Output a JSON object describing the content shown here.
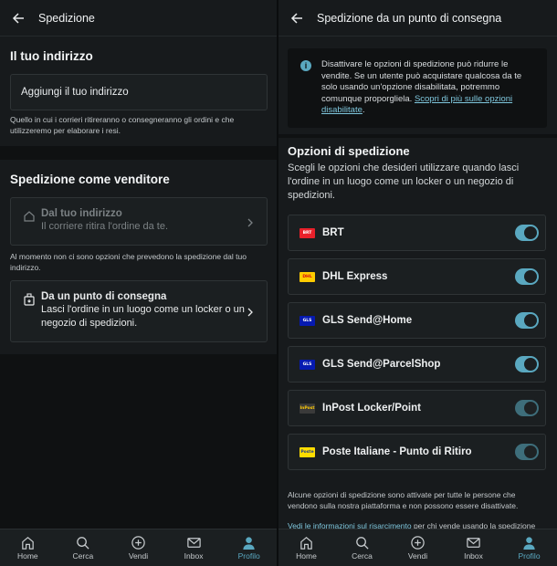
{
  "colors": {
    "accent": "#5aa8c0",
    "background": "#171a1c",
    "card": "#1b1f21"
  },
  "left": {
    "title": "Spedizione",
    "address_section": {
      "title": "Il tuo indirizzo",
      "add_button": "Aggiungi il tuo indirizzo",
      "helper": "Quello in cui i corrieri ritireranno o consegneranno gli ordini e che utilizzeremo per elaborare i resi."
    },
    "seller_section": {
      "title": "Spedizione come venditore",
      "home_option": {
        "title": "Dal tuo indirizzo",
        "subtitle": "Il corriere ritira l'ordine da te.",
        "icon": "home-icon"
      },
      "no_options_note": "Al momento non ci sono opzioni che prevedono la spedizione dal tuo indirizzo.",
      "dropoff_option": {
        "title": "Da un punto di consegna",
        "subtitle": "Lasci l'ordine in un luogo come un locker o un negozio di spedizioni.",
        "icon": "package-drop-icon"
      }
    }
  },
  "right": {
    "title": "Spedizione da un punto di consegna",
    "notice": {
      "text": "Disattivare le opzioni di spedizione può ridurre le vendite. Se un utente può acquistare qualcosa da te solo usando un'opzione disabilitata, potremmo comunque proporgliela. ",
      "link": "Scopri di più sulle opzioni disabilitate",
      "after": "."
    },
    "options_title": "Opzioni di spedizione",
    "options_desc": "Scegli le opzioni che desideri utilizzare quando lasci l'ordine in un luogo come un locker o un negozio di spedizioni.",
    "carriers": [
      {
        "name": "BRT",
        "logo_text": "BRT",
        "logo_bg": "#e8202a",
        "logo_fg": "#ffffff",
        "enabled": true
      },
      {
        "name": "DHL Express",
        "logo_text": "DHL",
        "logo_bg": "#ffcc00",
        "logo_fg": "#d40511",
        "enabled": true
      },
      {
        "name": "GLS Send@Home",
        "logo_text": "GLS",
        "logo_bg": "#061ab1",
        "logo_fg": "#ffffff",
        "enabled": true
      },
      {
        "name": "GLS Send@ParcelShop",
        "logo_text": "GLS",
        "logo_bg": "#061ab1",
        "logo_fg": "#ffffff",
        "enabled": true
      },
      {
        "name": "InPost Locker/Point",
        "logo_text": "InPost",
        "logo_bg": "#3a3a3a",
        "logo_fg": "#ffcb05",
        "enabled": true,
        "locked": true
      },
      {
        "name": "Poste Italiane - Punto di Ritiro",
        "logo_text": "Poste",
        "logo_bg": "#ffdd00",
        "logo_fg": "#1e3b8a",
        "enabled": true,
        "locked": true
      }
    ],
    "footer_note": "Alcune opzioni di spedizione sono attivate per tutte le persone che vendono sulla nostra piattaforma e non possono essere disattivate.",
    "footer_link": "Vedi le informazioni sul risarcimento",
    "footer_link_after": " per chi vende usando la spedizione"
  },
  "tabs": [
    {
      "label": "Home",
      "icon": "home-icon"
    },
    {
      "label": "Cerca",
      "icon": "search-icon"
    },
    {
      "label": "Vendi",
      "icon": "plus-circle-icon"
    },
    {
      "label": "Inbox",
      "icon": "mail-icon"
    },
    {
      "label": "Profilo",
      "icon": "profile-icon",
      "active": true
    }
  ]
}
